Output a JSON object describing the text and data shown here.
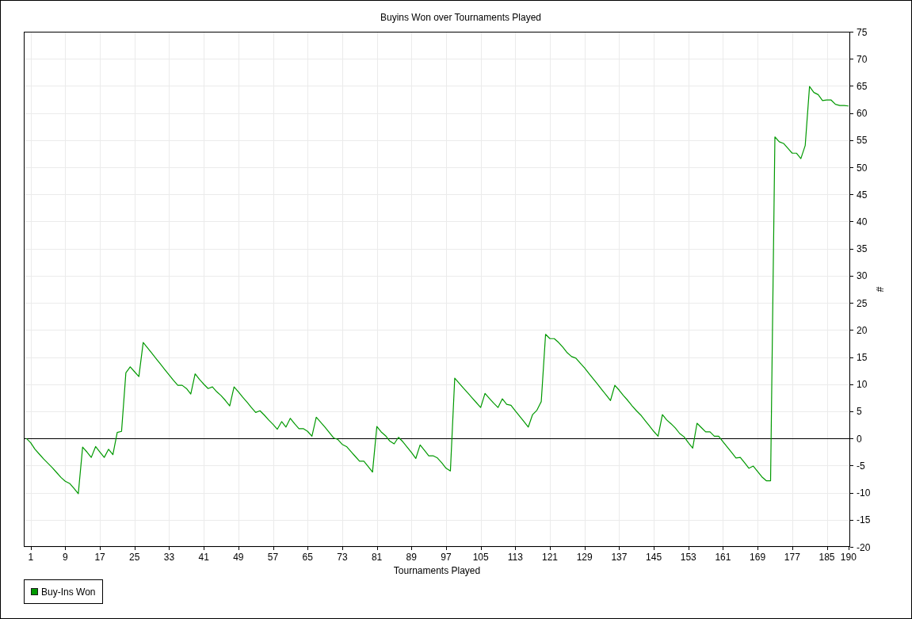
{
  "chart": {
    "chart_data": {
      "type": "line",
      "title": "Buyins Won over Tournaments Played",
      "xlabel": "Tournaments Played",
      "ylabel": "#",
      "x": [
        0,
        1,
        2,
        3,
        4,
        5,
        6,
        7,
        8,
        9,
        10,
        11,
        12,
        13,
        14,
        15,
        16,
        17,
        18,
        19,
        20,
        21,
        22,
        23,
        24,
        25,
        26,
        27,
        28,
        29,
        30,
        31,
        32,
        33,
        34,
        35,
        36,
        37,
        38,
        39,
        40,
        41,
        42,
        43,
        44,
        45,
        46,
        47,
        48,
        49,
        50,
        51,
        52,
        53,
        54,
        55,
        56,
        57,
        58,
        59,
        60,
        61,
        62,
        63,
        64,
        65,
        66,
        67,
        68,
        69,
        70,
        71,
        72,
        73,
        74,
        75,
        76,
        77,
        78,
        79,
        80,
        81,
        82,
        83,
        84,
        85,
        86,
        87,
        88,
        89,
        90,
        91,
        92,
        93,
        94,
        95,
        96,
        97,
        98,
        99,
        100,
        101,
        102,
        103,
        104,
        105,
        106,
        107,
        108,
        109,
        110,
        111,
        112,
        113,
        114,
        115,
        116,
        117,
        118,
        119,
        120,
        121,
        122,
        123,
        124,
        125,
        126,
        127,
        128,
        129,
        130,
        131,
        132,
        133,
        134,
        135,
        136,
        137,
        138,
        139,
        140,
        141,
        142,
        143,
        144,
        145,
        146,
        147,
        148,
        149,
        150,
        151,
        152,
        153,
        154,
        155,
        156,
        157,
        158,
        159,
        160,
        161,
        162,
        163,
        164,
        165,
        166,
        167,
        168,
        169,
        170,
        171,
        172,
        173,
        174,
        175,
        176,
        177,
        178,
        179,
        180,
        181,
        182,
        183,
        184,
        185,
        186,
        187,
        188,
        189,
        190
      ],
      "series": [
        {
          "name": "Buy-Ins Won",
          "color": "#009900",
          "values": [
            0,
            -0.8,
            -2.0,
            -2.9,
            -3.8,
            -4.6,
            -5.4,
            -6.3,
            -7.2,
            -7.9,
            -8.3,
            -9.2,
            -10.2,
            -1.6,
            -2.5,
            -3.5,
            -1.5,
            -2.5,
            -3.5,
            -2.0,
            -3.0,
            1.1,
            1.3,
            12.1,
            13.2,
            12.3,
            11.4,
            17.7,
            16.7,
            15.7,
            14.7,
            13.7,
            12.7,
            11.7,
            10.7,
            9.8,
            9.8,
            9.2,
            8.2,
            11.9,
            10.9,
            10.0,
            9.2,
            9.5,
            8.6,
            7.9,
            7.0,
            6.0,
            9.5,
            8.6,
            7.6,
            6.7,
            5.7,
            4.8,
            5.1,
            4.3,
            3.4,
            2.6,
            1.7,
            3.1,
            2.1,
            3.7,
            2.7,
            1.8,
            1.8,
            1.3,
            0.4,
            3.9,
            3.0,
            2.1,
            1.1,
            0.1,
            -0.2,
            -1.1,
            -1.5,
            -2.4,
            -3.3,
            -4.2,
            -4.2,
            -5.2,
            -6.2,
            2.2,
            1.2,
            0.5,
            -0.5,
            -1.0,
            0.2,
            -0.6,
            -1.6,
            -2.6,
            -3.7,
            -1.2,
            -2.2,
            -3.2,
            -3.2,
            -3.6,
            -4.5,
            -5.5,
            -6.0,
            11.1,
            10.2,
            9.3,
            8.4,
            7.5,
            6.6,
            5.7,
            8.3,
            7.4,
            6.5,
            5.7,
            7.3,
            6.3,
            6.1,
            5.1,
            4.1,
            3.1,
            2.1,
            4.4,
            5.2,
            6.8,
            19.2,
            18.4,
            18.4,
            17.7,
            16.8,
            15.8,
            15.1,
            14.8,
            13.9,
            13.0,
            12.0,
            11.0,
            10.0,
            9.0,
            8.0,
            7.0,
            9.8,
            8.9,
            7.9,
            7.0,
            6.0,
            5.1,
            4.3,
            3.3,
            2.3,
            1.3,
            0.4,
            4.4,
            3.4,
            2.7,
            1.9,
            0.9,
            0.3,
            -0.8,
            -1.8,
            2.8,
            2.0,
            1.2,
            1.2,
            0.4,
            0.4,
            -0.6,
            -1.6,
            -2.6,
            -3.6,
            -3.5,
            -4.5,
            -5.5,
            -5.1,
            -6.1,
            -7.1,
            -7.8,
            -7.8,
            55.6,
            54.7,
            54.4,
            53.5,
            52.6,
            52.6,
            51.6,
            54.0,
            64.9,
            63.8,
            63.4,
            62.3,
            62.4,
            62.4,
            61.6,
            61.4,
            61.4,
            61.3
          ]
        }
      ],
      "xlim": [
        -0.6,
        190.4
      ],
      "ylim": [
        -20,
        75
      ],
      "xticks": [
        1,
        9,
        17,
        25,
        33,
        41,
        49,
        57,
        65,
        73,
        81,
        89,
        97,
        105,
        113,
        121,
        129,
        137,
        145,
        153,
        161,
        169,
        177,
        185,
        190
      ],
      "yticks": [
        -20,
        -15,
        -10,
        -5,
        0,
        5,
        10,
        15,
        20,
        25,
        30,
        35,
        40,
        45,
        50,
        55,
        60,
        65,
        70,
        75
      ],
      "grid": true,
      "ref_lines": [
        {
          "axis": "y",
          "value": 0
        }
      ]
    }
  }
}
